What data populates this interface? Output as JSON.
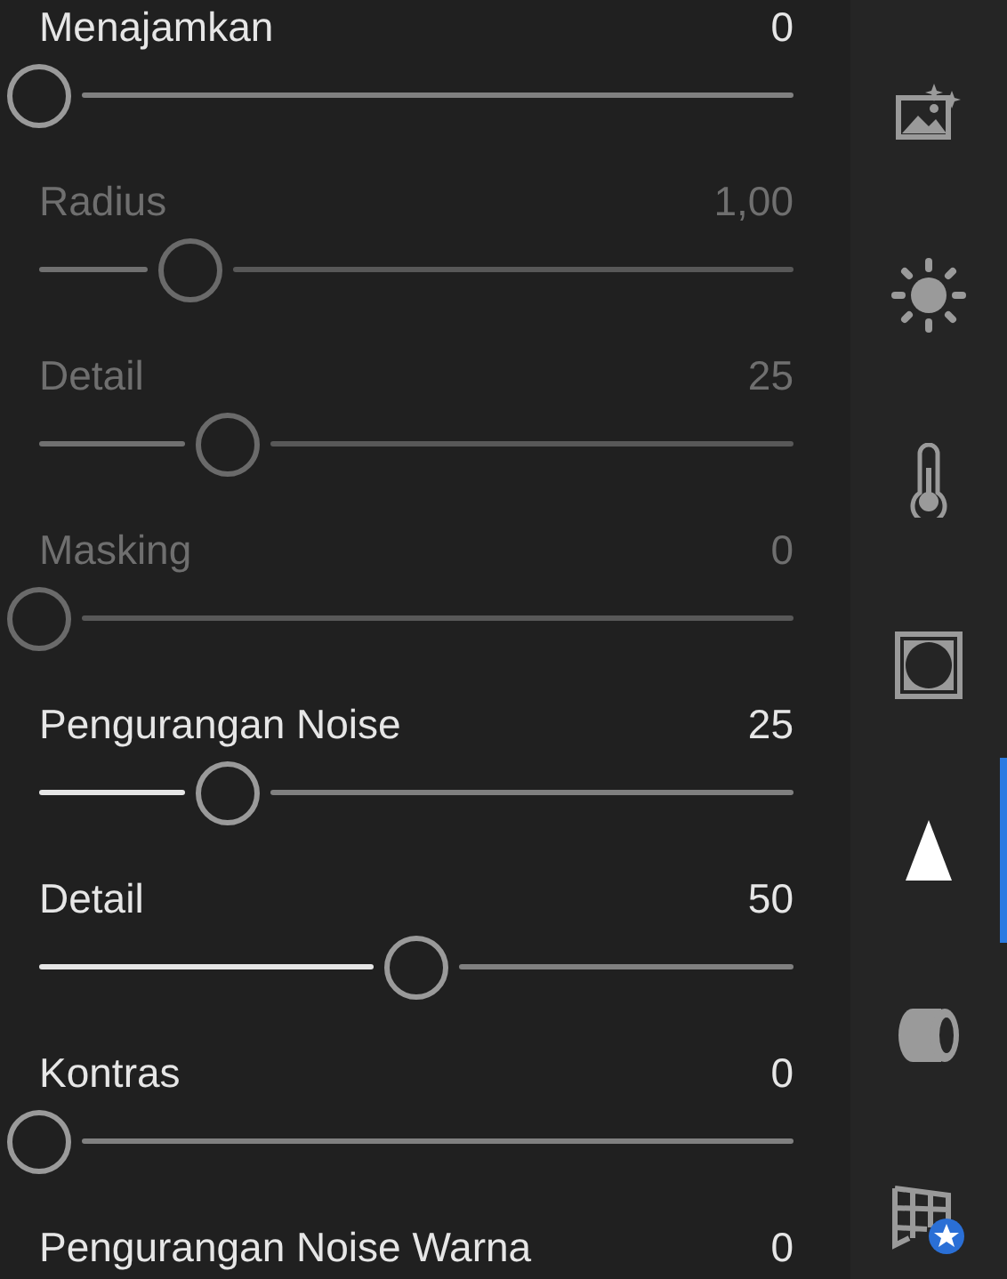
{
  "sliders": [
    {
      "label": "Menajamkan",
      "value": "0",
      "level": 0,
      "disabled": false
    },
    {
      "label": "Radius",
      "value": "1,00",
      "level": 0.2,
      "disabled": true
    },
    {
      "label": "Detail",
      "value": "25",
      "level": 0.25,
      "disabled": true
    },
    {
      "label": "Masking",
      "value": "0",
      "level": 0,
      "disabled": true
    },
    {
      "label": "Pengurangan Noise",
      "value": "25",
      "level": 0.25,
      "disabled": false
    },
    {
      "label": "Detail",
      "value": "50",
      "level": 0.5,
      "disabled": false
    },
    {
      "label": "Kontras",
      "value": "0",
      "level": 0,
      "disabled": false
    },
    {
      "label": "Pengurangan Noise Warna",
      "value": "0",
      "disabled": false
    }
  ],
  "tools": [
    {
      "kind": "auto",
      "selected": false
    },
    {
      "kind": "light",
      "selected": false
    },
    {
      "kind": "color",
      "selected": false
    },
    {
      "kind": "effects",
      "selected": false
    },
    {
      "kind": "detail",
      "selected": true
    },
    {
      "kind": "optics",
      "selected": false
    },
    {
      "kind": "geometry",
      "selected": false
    }
  ]
}
